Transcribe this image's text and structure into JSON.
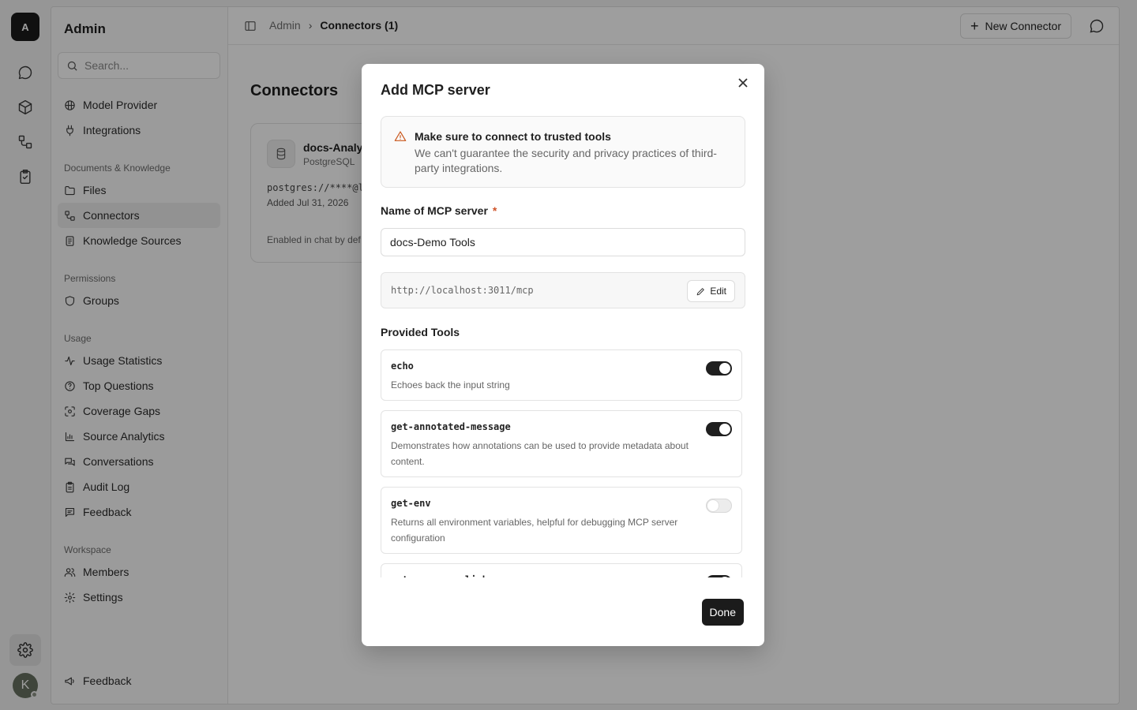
{
  "rail": {
    "logo": "A",
    "avatar": "K"
  },
  "sidebar": {
    "title": "Admin",
    "search_placeholder": "Search...",
    "items_top": [
      {
        "label": "Model Provider",
        "icon": "model-icon"
      },
      {
        "label": "Integrations",
        "icon": "plug-icon"
      }
    ],
    "section_docs": "Documents & Knowledge",
    "items_docs": [
      {
        "label": "Files",
        "icon": "folder-icon"
      },
      {
        "label": "Connectors",
        "icon": "connector-icon"
      },
      {
        "label": "Knowledge Sources",
        "icon": "book-icon"
      }
    ],
    "section_perm": "Permissions",
    "items_perm": [
      {
        "label": "Groups",
        "icon": "shield-icon"
      }
    ],
    "section_usage": "Usage",
    "items_usage": [
      {
        "label": "Usage Statistics",
        "icon": "activity-icon"
      },
      {
        "label": "Top Questions",
        "icon": "question-icon"
      },
      {
        "label": "Coverage Gaps",
        "icon": "scan-icon"
      },
      {
        "label": "Source Analytics",
        "icon": "bar-chart-icon"
      },
      {
        "label": "Conversations",
        "icon": "chats-icon"
      },
      {
        "label": "Audit Log",
        "icon": "clipboard-icon"
      },
      {
        "label": "Feedback",
        "icon": "message-icon"
      }
    ],
    "section_workspace": "Workspace",
    "items_workspace": [
      {
        "label": "Members",
        "icon": "users-icon"
      },
      {
        "label": "Settings",
        "icon": "gear-icon"
      }
    ],
    "footer_feedback": "Feedback"
  },
  "topbar": {
    "crumb_root": "Admin",
    "crumb_sep": "›",
    "crumb_current": "Connectors (1)",
    "new_button": "New Connector"
  },
  "page": {
    "title": "Connectors",
    "connector": {
      "name": "docs-Analyt",
      "type": "PostgreSQL",
      "url": "postgres://****@l",
      "added": "Added Jul 31, 2026",
      "footer": "Enabled in chat by def"
    }
  },
  "modal": {
    "title": "Add MCP server",
    "warning_title": "Make sure to connect to trusted tools",
    "warning_desc": "We can't guarantee the security and privacy practices of third-party integrations.",
    "name_label": "Name of MCP server",
    "required_mark": "*",
    "name_value": "docs-Demo Tools",
    "url": "http://localhost:3011/mcp",
    "edit_label": "Edit",
    "tools_label": "Provided Tools",
    "tools": [
      {
        "name": "echo",
        "desc": "Echoes back the input string",
        "enabled": true
      },
      {
        "name": "get-annotated-message",
        "desc": "Demonstrates how annotations can be used to provide metadata about content.",
        "enabled": true
      },
      {
        "name": "get-env",
        "desc": "Returns all environment variables, helpful for debugging MCP server configuration",
        "enabled": false
      },
      {
        "name": "get-resource-links",
        "desc": "",
        "enabled": true
      }
    ],
    "done_label": "Done"
  }
}
